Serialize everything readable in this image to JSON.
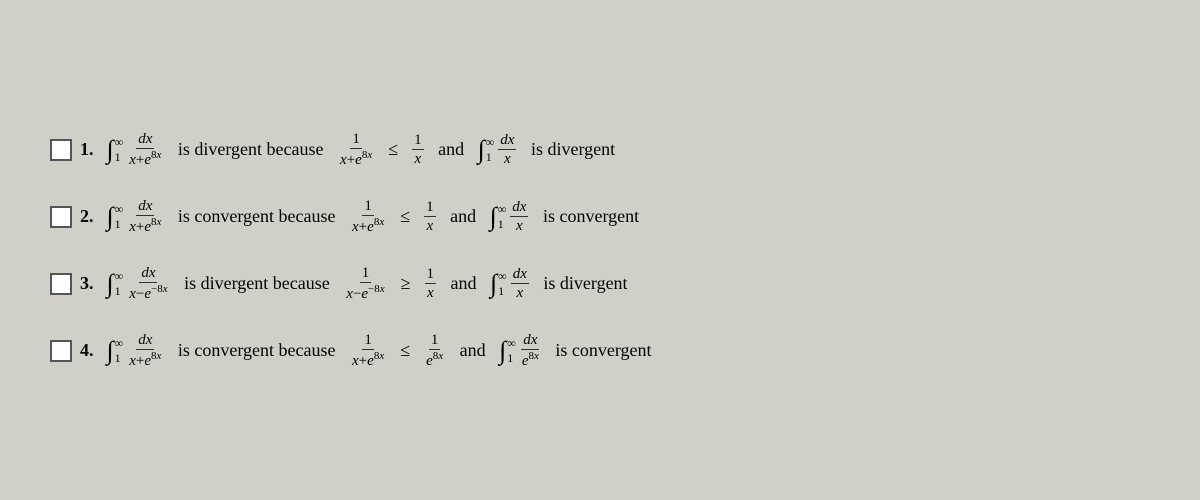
{
  "rows": [
    {
      "id": 1,
      "number": "1.",
      "integral_main": "∫₁^∞ dx/(x+e^(8x))",
      "verdict": "is divergent",
      "because": "because",
      "comparison_frac_num": "1",
      "comparison_frac_den": "x+e^(8x)",
      "rel": "≤",
      "simple_frac_num": "1",
      "simple_frac_den": "x",
      "and": "and",
      "integral_simple": "∫₁^∞ dx/x",
      "verdict2": "is divergent"
    },
    {
      "id": 2,
      "number": "2.",
      "integral_main": "∫₁^∞ dx/(x+e^(8x))",
      "verdict": "is convergent",
      "because": "because",
      "rel": "≤",
      "verdict2": "is convergent"
    },
    {
      "id": 3,
      "number": "3.",
      "integral_main": "∫₁^∞ dx/(x-e^(-8x))",
      "verdict": "is divergent",
      "because": "because",
      "rel": "≥",
      "verdict2": "is divergent"
    },
    {
      "id": 4,
      "number": "4.",
      "integral_main": "∫₁^∞ dx/(x+e^(8x))",
      "verdict": "is convergent",
      "because": "because",
      "rel": "≤",
      "verdict2": "is convergent"
    }
  ]
}
